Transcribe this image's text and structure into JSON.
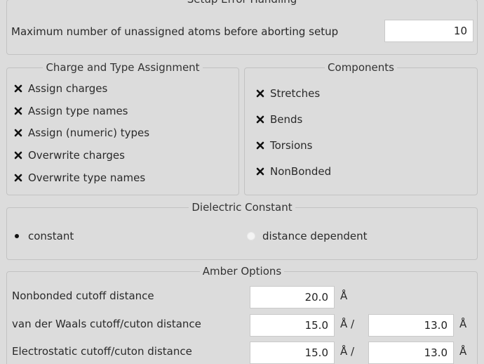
{
  "setup_error": {
    "title": "Setup Error Handling",
    "max_unassigned_label": "Maximum number of unassigned atoms before aborting setup",
    "max_unassigned_value": "10"
  },
  "charge_type": {
    "title": "Charge and Type Assignment",
    "items": [
      {
        "label": "Assign charges",
        "checked": true
      },
      {
        "label": "Assign type names",
        "checked": true
      },
      {
        "label": "Assign (numeric) types",
        "checked": true
      },
      {
        "label": "Overwrite charges",
        "checked": true
      },
      {
        "label": "Overwrite type names",
        "checked": true
      }
    ]
  },
  "components": {
    "title": "Components",
    "items": [
      {
        "label": "Stretches",
        "checked": true
      },
      {
        "label": "Bends",
        "checked": true
      },
      {
        "label": "Torsions",
        "checked": true
      },
      {
        "label": "NonBonded",
        "checked": true
      }
    ]
  },
  "dielectric": {
    "title": "Dielectric Constant",
    "options": [
      {
        "label": "constant",
        "selected": true
      },
      {
        "label": "distance dependent",
        "selected": false
      }
    ]
  },
  "amber": {
    "title": "Amber Options",
    "nonbonded_label": "Nonbonded cutoff distance",
    "nonbonded_value": "20.0",
    "nonbonded_unit": "Å",
    "vdw_label": "van der Waals cutoff/cuton distance",
    "vdw_cutoff": "15.0",
    "vdw_unit_sep": "Å /",
    "vdw_cuton": "13.0",
    "vdw_unit": "Å",
    "elec_label": "Electrostatic cutoff/cuton distance",
    "elec_cutoff": "15.0",
    "elec_unit_sep": "Å /",
    "elec_cuton": "13.0",
    "elec_unit": "Å"
  }
}
